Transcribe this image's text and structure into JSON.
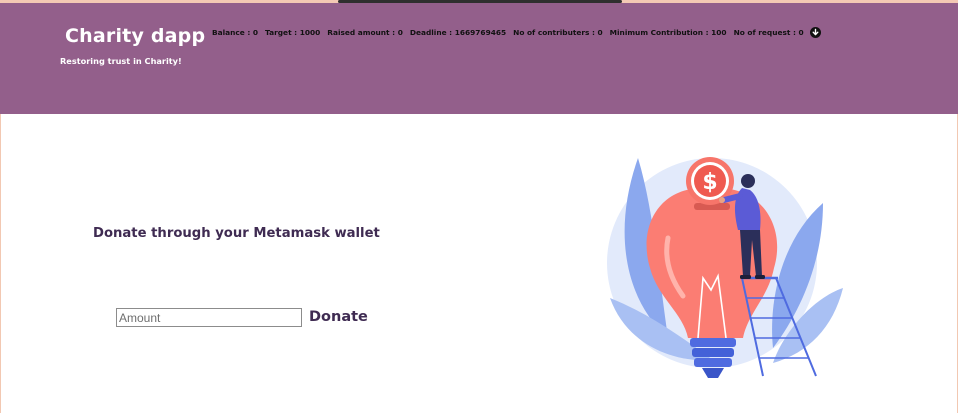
{
  "header": {
    "title": "Charity dapp",
    "subtitle": "Restoring trust in Charity!",
    "stats": [
      "Balance : 0",
      "Target : 1000",
      "Raised amount : 0",
      "Deadline : 1669769465",
      "No of contributers : 0",
      "Minimum Contribution : 100",
      "No of request : 0"
    ],
    "expand_icon": "arrow-circle-down-icon"
  },
  "main": {
    "heading": "Donate through your Metamask wallet",
    "amount_placeholder": "Amount",
    "amount_value": "",
    "donate_label": "Donate",
    "illustration": "lightbulb-piggy-bank-coin-illustration"
  },
  "colors": {
    "header_bg": "#935f8b",
    "heading_text": "#3f2b52",
    "bulb": "#fb7d73",
    "leaves": "#8ba8ee"
  }
}
